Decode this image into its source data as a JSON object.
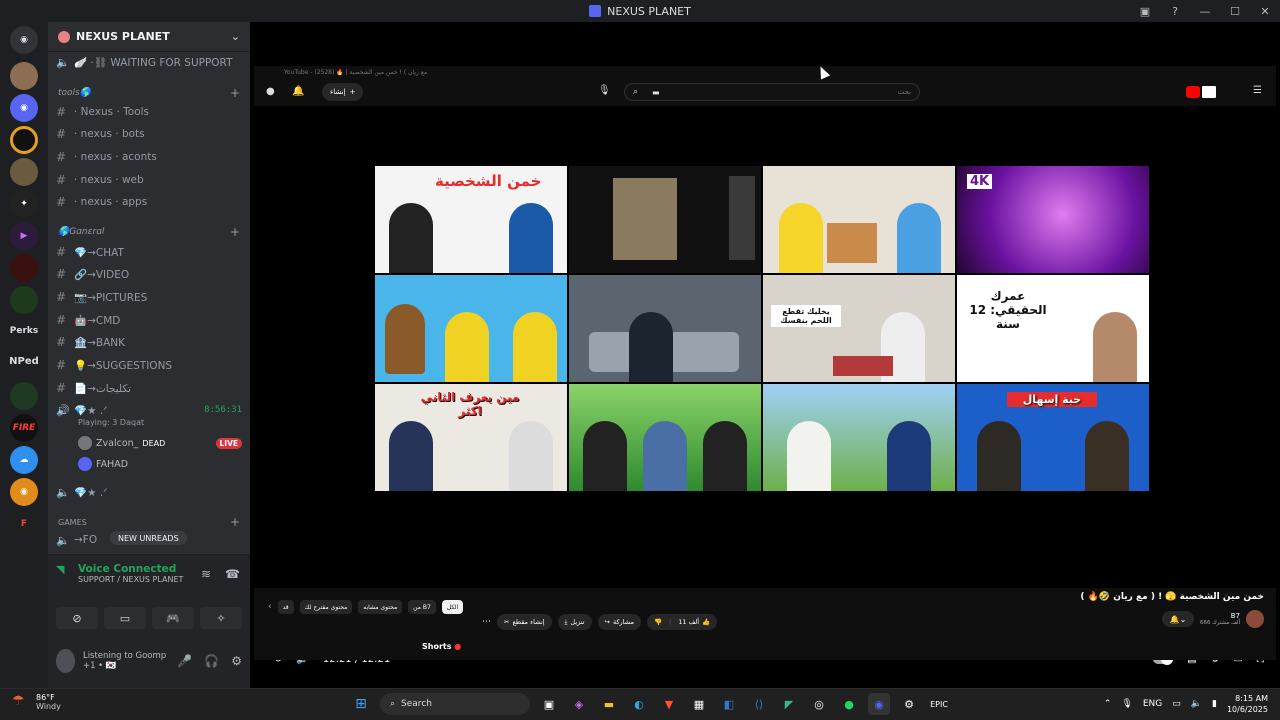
{
  "window": {
    "title": "NEXUS PLANET"
  },
  "rail": {
    "perks_label": "Perks",
    "nped_label": "NPed",
    "fire_label": "FIRE"
  },
  "server": {
    "name": "NEXUS PLANET"
  },
  "channels": {
    "waiting": "🪽 ·⛓ WAITING FOR SUPPORT",
    "cat_tools": "tools🌎",
    "tools_items": [
      "· Nexus · Tools",
      "· nexus · bots",
      "· nexus · aconts",
      "· nexus · web",
      "· nexus · apps"
    ],
    "cat_general": "🌎Gɑnɛrɑl",
    "general_items": [
      "💎→CHAT",
      "🔗→VIDEO",
      "📷→PICTURES",
      "🤖→CMD",
      "🏦→BANK",
      "💡→SUGGESTIONS",
      "📄→تكليجات"
    ],
    "voice_channel": "💎★ .ᐟ",
    "voice_time": "8:56:31",
    "voice_playing": "Playing: 3 Daqat",
    "voice_user1": "Zvalcon_",
    "voice_user1_badge": "DEAD",
    "live_label": "LIVE",
    "voice_user2": "FAHAD",
    "voice_channel2": "💎★ .ᐟ",
    "cat_games": "GAMES",
    "games_item": "→FO",
    "new_unreads": "NEW UNREADS"
  },
  "voice_panel": {
    "status": "Voice Connected",
    "location": "SUPPORT / NEXUS PLANET"
  },
  "user_panel": {
    "activity": "Listening to Goomp +1 • 🇰🇷"
  },
  "youtube": {
    "tab_title": "YouTube - (2528) 🔥 | مع ريان ) ! خمن مين الشخصية",
    "search_placeholder": "بحث",
    "create_label": "إنشاء",
    "time_display": "12:21 / 12:21",
    "video_title": "خمن مين الشخصية 🫣 ! ( مع ريان 🤣🔥 )",
    "channel_name": "B7",
    "channel_subs": "666 ألف مشترك",
    "chips": [
      "الكل",
      "من B7",
      "محتوى مشابه",
      "محتوى مقترح لك",
      "قد"
    ],
    "actions": [
      "11 ألف",
      "",
      "مشاركة",
      "تنزيل",
      "إنشاء مقطع"
    ],
    "shorts_label": "Shorts",
    "thumb_captions": {
      "t1": "خمن الشخصية",
      "t4": "4K",
      "t7": "يخليك تقطع اللحم بنفسك",
      "t8": "عمرك الحقيقي: 12 سنة",
      "t9": "مين يعرف الثاني اكثر",
      "t12": "حبة إسهال"
    }
  },
  "taskbar": {
    "temp": "86°F",
    "condition": "Windy",
    "search_label": "Search",
    "lang": "ENG",
    "time": "8:15 AM",
    "date": "10/6/2025"
  },
  "colors": {
    "accent": "#5865f2",
    "online": "#23a559",
    "yt_red": "#ff0000",
    "live": "#da373c"
  }
}
